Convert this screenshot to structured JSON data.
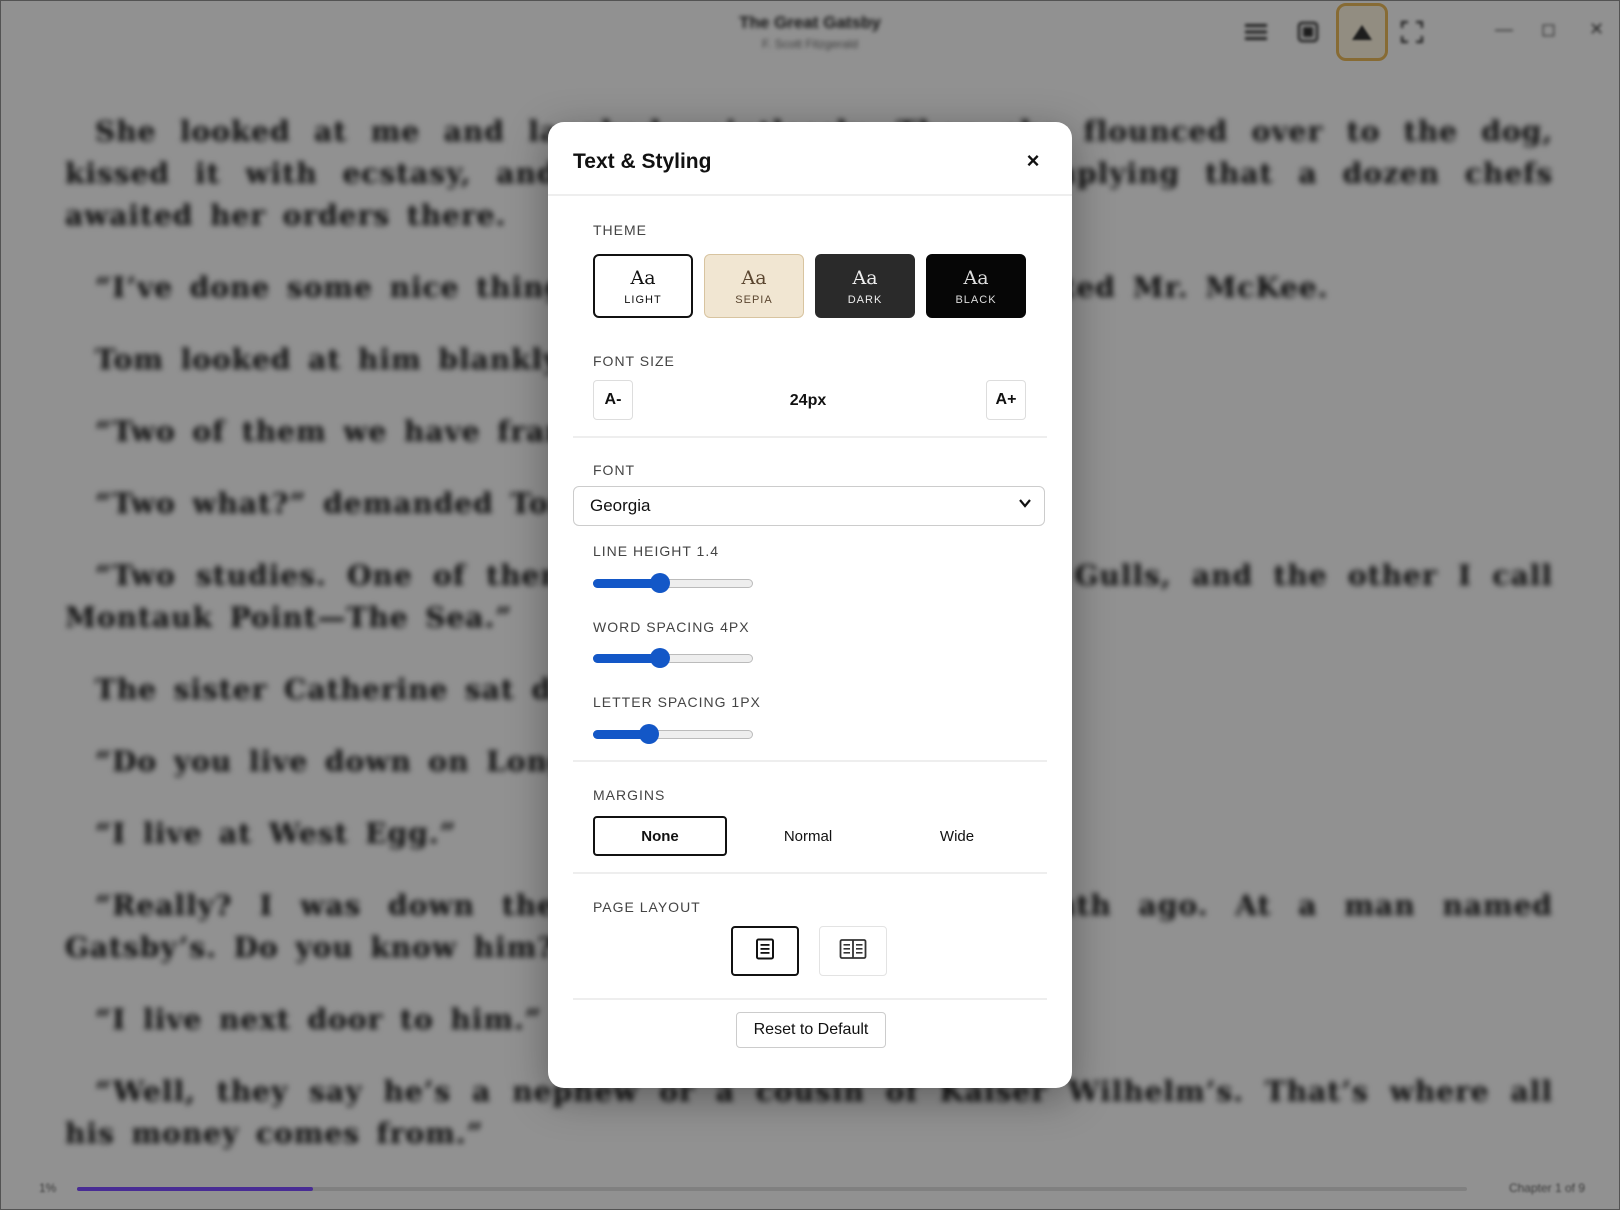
{
  "reader": {
    "book_title": "The Great Gatsby",
    "book_author": "F. Scott Fitzgerald",
    "paragraphs": [
      "She looked at me and laughed pointlessly. Then she flounced over to the dog, kissed it with ecstasy, and swept into the kitchen, implying that a dozen chefs awaited her orders there.",
      "“I’ve done some nice things out on Long Island,” asserted Mr. McKee.",
      "Tom looked at him blankly.",
      "“Two of them we have framed downstairs.”",
      "“Two what?” demanded Tom.",
      "“Two studies. One of them I call Montauk Point—The Gulls, and the other I call Montauk Point—The Sea.”",
      "The sister Catherine sat down beside me on the couch.",
      "“Do you live down on Long Island, too?” she inquired.",
      "“I live at West Egg.”",
      "“Really? I was down there at a party about a month ago. At a man named Gatsby’s. Do you know him?”",
      "“I live next door to him.”",
      "“Well, they say he’s a nephew or a cousin of Kaiser Wilhelm’s. That’s where all his money comes from.”"
    ],
    "footer_left": "1%",
    "footer_right": "Chapter 1 of 9",
    "progress_percent": 17
  },
  "toolbar": {
    "toc_icon": "list-icon",
    "bookmark_icon": "bookmark-icon",
    "styling_icon": "text-styling-icon",
    "fullscreen_icon": "fullscreen-icon",
    "minimize_glyph": "—",
    "maximize_glyph": "◻",
    "close_glyph": "✕",
    "active_accent": "#e9b95b"
  },
  "modal": {
    "title": "Text & Styling",
    "close_label": "×",
    "theme": {
      "label": "THEME",
      "options": [
        {
          "aa": "Aa",
          "name": "LIGHT"
        },
        {
          "aa": "Aa",
          "name": "SEPIA"
        },
        {
          "aa": "Aa",
          "name": "DARK"
        },
        {
          "aa": "Aa",
          "name": "BLACK"
        }
      ],
      "selected": "LIGHT"
    },
    "font_size": {
      "label": "FONT SIZE",
      "decrease": "A-",
      "increase": "A+",
      "value": "24px"
    },
    "font": {
      "label": "FONT",
      "selected": "Georgia",
      "chevron": "⌄"
    },
    "line_height": {
      "label": "LINE HEIGHT 1.4",
      "fraction": 0.42
    },
    "word_spacing": {
      "label": "WORD SPACING 4PX",
      "fraction": 0.42
    },
    "letter_spacing": {
      "label": "LETTER SPACING 1PX",
      "fraction": 0.35
    },
    "margins": {
      "label": "MARGINS",
      "options": [
        "None",
        "Normal",
        "Wide"
      ],
      "selected": "None"
    },
    "page_layout": {
      "label": "PAGE LAYOUT",
      "options": [
        "single-page-icon",
        "two-page-icon"
      ],
      "selected": "single-page-icon"
    },
    "reset_label": "Reset to Default",
    "accent_color": "#1357c7"
  }
}
